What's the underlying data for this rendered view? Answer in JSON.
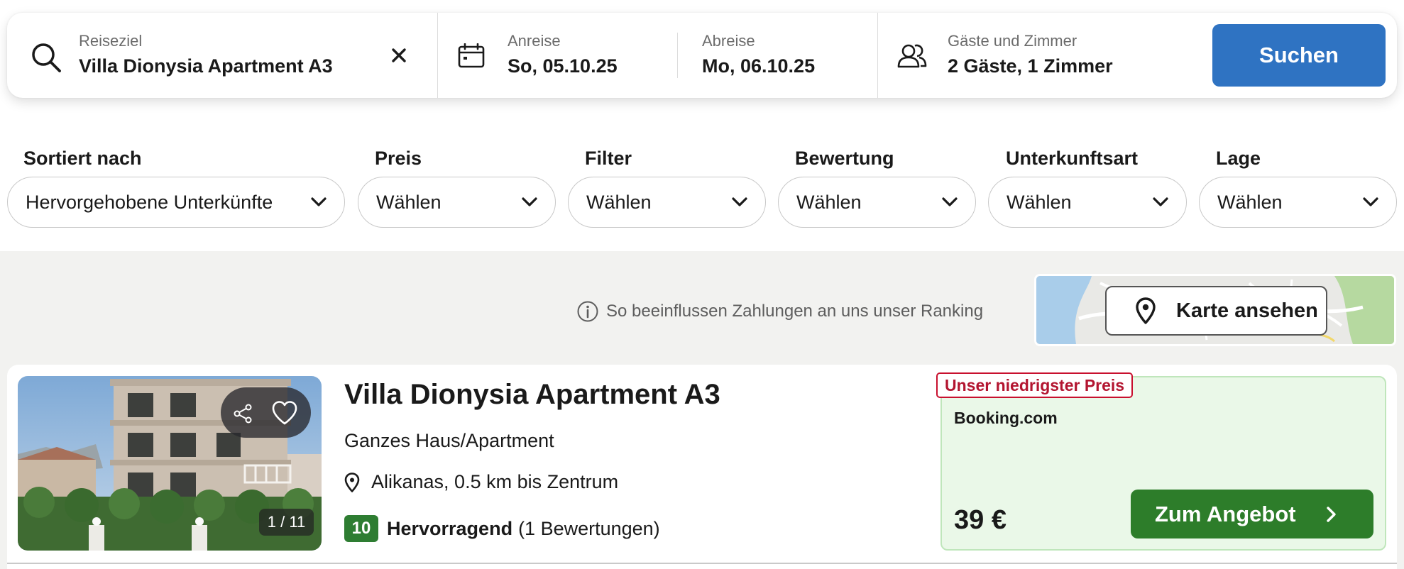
{
  "search": {
    "destination_label": "Reiseziel",
    "destination_value": "Villa Dionysia Apartment A3",
    "checkin_label": "Anreise",
    "checkin_value": "So, 05.10.25",
    "checkout_label": "Abreise",
    "checkout_value": "Mo, 06.10.25",
    "guests_label": "Gäste und Zimmer",
    "guests_value": "2 Gäste, 1 Zimmer",
    "search_button": "Suchen",
    "accent_color": "#2f73c2"
  },
  "filters": [
    {
      "title": "Sortiert nach",
      "value": "Hervorgehobene Unterkünfte"
    },
    {
      "title": "Preis",
      "value": "Wählen"
    },
    {
      "title": "Filter",
      "value": "Wählen"
    },
    {
      "title": "Bewertung",
      "value": "Wählen"
    },
    {
      "title": "Unterkunftsart",
      "value": "Wählen"
    },
    {
      "title": "Lage",
      "value": "Wählen"
    }
  ],
  "ranking_info": "So beeinflussen Zahlungen an uns unser Ranking",
  "map_button": "Karte ansehen",
  "result": {
    "title": "Villa Dionysia Apartment A3",
    "type": "Ganzes Haus/Apartment",
    "location": "Alikanas, 0.5 km bis Zentrum",
    "rating_score": "10",
    "rating_label": "Hervorragend",
    "rating_count": "(1 Bewertungen)",
    "photo_counter": "1 / 11",
    "offer": {
      "badge": "Unser niedrigster Preis",
      "provider": "Booking.com",
      "price": "39 €",
      "button": "Zum Angebot",
      "badge_color": "#c8102e",
      "button_color": "#2d7d2a"
    }
  },
  "icons": [
    "search-icon",
    "clear-icon",
    "calendar-icon",
    "guests-icon",
    "chevron-down-icon",
    "info-icon",
    "map-pin-icon",
    "share-icon",
    "heart-icon",
    "chevron-right-icon"
  ]
}
